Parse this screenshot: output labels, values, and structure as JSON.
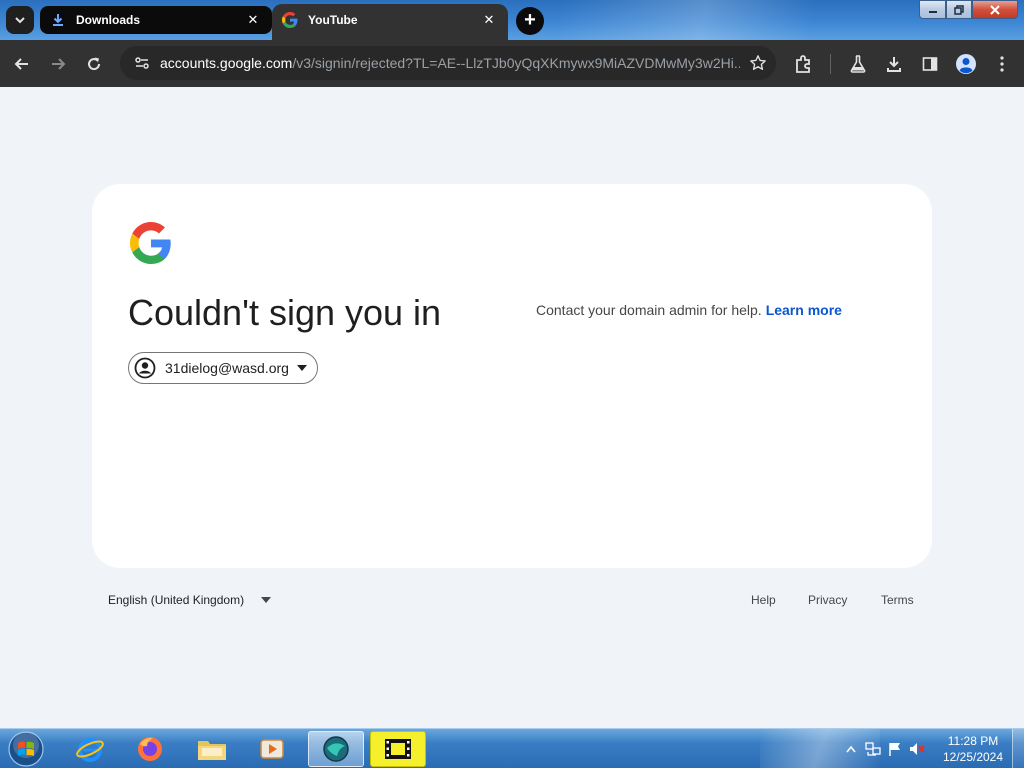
{
  "browser": {
    "tabs": [
      {
        "title": "Downloads",
        "icon": "download-icon",
        "active": false
      },
      {
        "title": "YouTube",
        "icon": "google-g-icon",
        "active": true
      }
    ],
    "new_tab_label": "+",
    "window_controls": {
      "minimize": "minimize-icon",
      "maximize": "restore-icon",
      "close": "close-icon"
    }
  },
  "toolbar": {
    "url_host": "accounts.google.com",
    "url_path": "/v3/signin/rejected?TL=AE--LlzTJb0yQqXKmywx9MiAZVDMwMy3w2Hi..."
  },
  "page": {
    "headline": "Couldn't sign you in",
    "account_email": "31dielog@wasd.org",
    "help_text": "Contact your domain admin for help.",
    "learn_more": "Learn more",
    "language": "English (United Kingdom)",
    "footer_links": [
      "Help",
      "Privacy",
      "Terms"
    ],
    "colors": {
      "page_bg": "#f0f4f9",
      "card_bg": "#ffffff",
      "link": "#0b57d0"
    }
  },
  "taskbar": {
    "apps": [
      "internet-explorer",
      "firefox",
      "file-explorer",
      "media-player",
      "greenshot",
      "video-editor"
    ],
    "time": "11:28 PM",
    "date": "12/25/2024"
  }
}
